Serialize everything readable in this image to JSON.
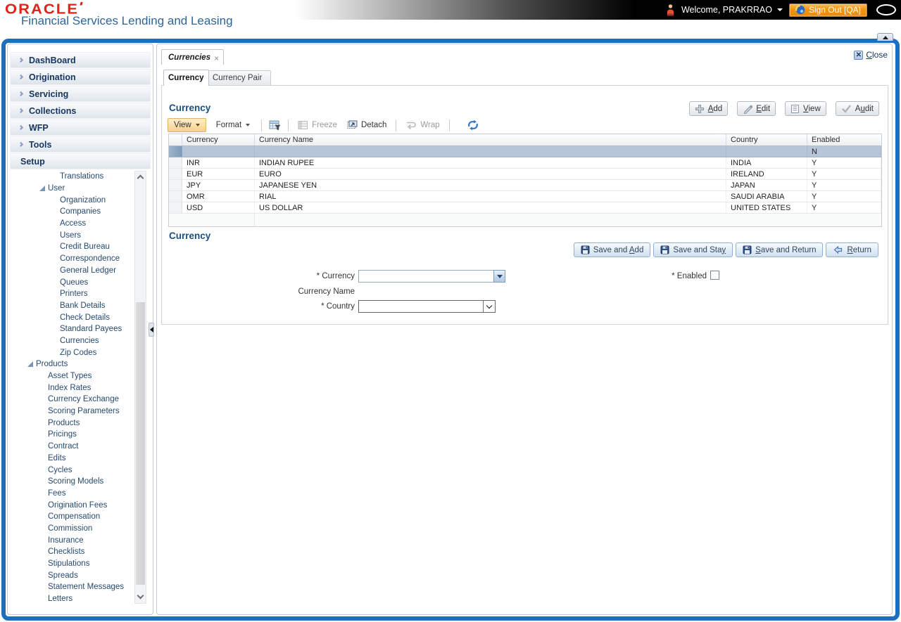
{
  "colors": {
    "frame_blue": "#1d6fbd",
    "oracle_red": "#e2231a",
    "signout_orange": "#f09312",
    "selected_row": "#b6c6d8"
  },
  "header": {
    "logo": "ORACLE",
    "subtitle": "Financial Services Lending and Leasing",
    "welcome": "Welcome, PRAKRRAO",
    "sign_out": "Sign Out [QA]"
  },
  "sidebar": {
    "menu": [
      {
        "label": "DashBoard"
      },
      {
        "label": "Origination"
      },
      {
        "label": "Servicing"
      },
      {
        "label": "Collections"
      },
      {
        "label": "WFP"
      },
      {
        "label": "Tools"
      },
      {
        "label": "Setup",
        "expanded": true
      }
    ],
    "tree": [
      {
        "label": "Translations",
        "indent": 3
      },
      {
        "label": "User",
        "indent": 2,
        "expanded": true
      },
      {
        "label": "Organization",
        "indent": 3
      },
      {
        "label": "Companies",
        "indent": 3
      },
      {
        "label": "Access",
        "indent": 3
      },
      {
        "label": "Users",
        "indent": 3
      },
      {
        "label": "Credit Bureau",
        "indent": 3
      },
      {
        "label": "Correspondence",
        "indent": 3
      },
      {
        "label": "General Ledger",
        "indent": 3
      },
      {
        "label": "Queues",
        "indent": 3
      },
      {
        "label": "Printers",
        "indent": 3
      },
      {
        "label": "Bank Details",
        "indent": 3
      },
      {
        "label": "Check Details",
        "indent": 3
      },
      {
        "label": "Standard Payees",
        "indent": 3
      },
      {
        "label": "Currencies",
        "indent": 3
      },
      {
        "label": "Zip Codes",
        "indent": 3
      },
      {
        "label": "Products",
        "indent": 1,
        "expanded": true
      },
      {
        "label": "Asset Types",
        "indent": 2
      },
      {
        "label": "Index Rates",
        "indent": 2
      },
      {
        "label": "Currency Exchange",
        "indent": 2
      },
      {
        "label": "Scoring Parameters",
        "indent": 2
      },
      {
        "label": "Products",
        "indent": 2
      },
      {
        "label": "Pricings",
        "indent": 2
      },
      {
        "label": "Contract",
        "indent": 2
      },
      {
        "label": "Edits",
        "indent": 2
      },
      {
        "label": "Cycles",
        "indent": 2
      },
      {
        "label": "Scoring Models",
        "indent": 2
      },
      {
        "label": "Fees",
        "indent": 2
      },
      {
        "label": "Origination Fees",
        "indent": 2
      },
      {
        "label": "Compensation",
        "indent": 2
      },
      {
        "label": "Commission",
        "indent": 2
      },
      {
        "label": "Insurance",
        "indent": 2
      },
      {
        "label": "Checklists",
        "indent": 2
      },
      {
        "label": "Stipulations",
        "indent": 2
      },
      {
        "label": "Spreads",
        "indent": 2
      },
      {
        "label": "Statement Messages",
        "indent": 2
      },
      {
        "label": "Letters",
        "indent": 2
      }
    ]
  },
  "main": {
    "doc_tab": "Currencies",
    "close": {
      "label": "Close",
      "ul": 0
    },
    "tabs": [
      {
        "label": "Currency"
      },
      {
        "label": "Currency Pair"
      }
    ],
    "grid": {
      "title": "Currency",
      "toolbar": {
        "view": "View",
        "format": "Format",
        "freeze": "Freeze",
        "detach": "Detach",
        "wrap": "Wrap"
      },
      "actions": [
        {
          "label": "Add",
          "ul": 0
        },
        {
          "label": "Edit",
          "ul": 0
        },
        {
          "label": "View",
          "ul": 0
        },
        {
          "label": "Audit",
          "ul": 1
        }
      ],
      "columns": [
        "Currency",
        "Currency Name",
        "Country",
        "Enabled"
      ],
      "selected_row": {
        "currency": "",
        "currency_name": "",
        "country": "",
        "enabled": "N"
      },
      "rows": [
        {
          "currency": "INR",
          "currency_name": "INDIAN RUPEE",
          "country": "INDIA",
          "enabled": "Y"
        },
        {
          "currency": "EUR",
          "currency_name": "EURO",
          "country": "IRELAND",
          "enabled": "Y"
        },
        {
          "currency": "JPY",
          "currency_name": "JAPANESE YEN",
          "country": "JAPAN",
          "enabled": "Y"
        },
        {
          "currency": "OMR",
          "currency_name": "RIAL",
          "country": "SAUDI ARABIA",
          "enabled": "Y"
        },
        {
          "currency": "USD",
          "currency_name": "US DOLLAR",
          "country": "UNITED STATES",
          "enabled": "Y"
        }
      ]
    },
    "form": {
      "title": "Currency",
      "buttons": [
        {
          "label": "Save and Add",
          "ul": 9
        },
        {
          "label": "Save and Stay",
          "ul": 12
        },
        {
          "label": "Save and Return",
          "ul": 0
        },
        {
          "label": "Return",
          "ul": 0
        }
      ],
      "labels": {
        "currency": "* Currency",
        "currency_name": "Currency Name",
        "country": "* Country",
        "enabled": "* Enabled"
      }
    }
  }
}
